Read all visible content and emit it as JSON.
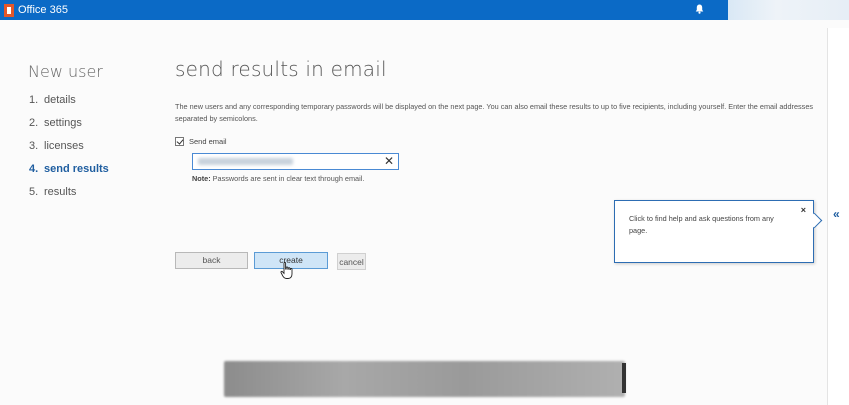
{
  "topbar": {
    "brand": "Office 365",
    "icons": {
      "logo": "office-logo",
      "bell": "bell-icon"
    }
  },
  "nav": {
    "title": "New user",
    "items": [
      {
        "num": "1.",
        "label": "details",
        "active": false
      },
      {
        "num": "2.",
        "label": "settings",
        "active": false
      },
      {
        "num": "3.",
        "label": "licenses",
        "active": false
      },
      {
        "num": "4.",
        "label": "send results",
        "active": true
      },
      {
        "num": "5.",
        "label": "results",
        "active": false
      }
    ]
  },
  "main": {
    "title": "send results in email",
    "description": "The new users and any corresponding temporary passwords will be displayed on the next page. You can also email these results to up to five recipients, including yourself. Enter the email addresses separated by semicolons.",
    "send_email_label": "Send email",
    "send_email_checked": true,
    "clear_label": "✕",
    "note_bold": "Note:",
    "note_text": " Passwords are sent in clear text through email."
  },
  "buttons": {
    "back": "back",
    "create": "create",
    "cancel": "cancel"
  },
  "help": {
    "text": "Click to find help and ask questions from any page.",
    "close": "×"
  },
  "right_panel": {
    "chevron": "«"
  },
  "colors": {
    "topbar": "#0b6ac6",
    "accent": "#1f5ea0",
    "logo": "#e3572a",
    "popup_border": "#2d6db3"
  }
}
